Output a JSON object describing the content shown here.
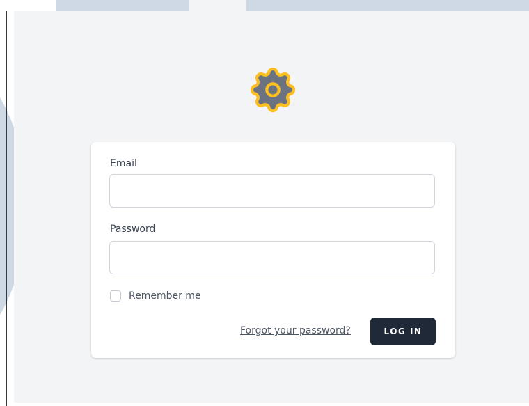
{
  "colors": {
    "page_bg": "#f3f4f6",
    "card_bg": "#ffffff",
    "logo_fill": "#6b7280",
    "logo_stroke": "#fbbf24",
    "button_bg": "#1f2937",
    "button_text": "#ffffff",
    "text": "#374151"
  },
  "logo": {
    "icon": "gear-icon"
  },
  "form": {
    "email_label": "Email",
    "email_value": "",
    "password_label": "Password",
    "password_value": "",
    "remember_label": "Remember me",
    "remember_checked": false,
    "forgot_link": "Forgot your password?",
    "login_button": "LOG IN"
  }
}
